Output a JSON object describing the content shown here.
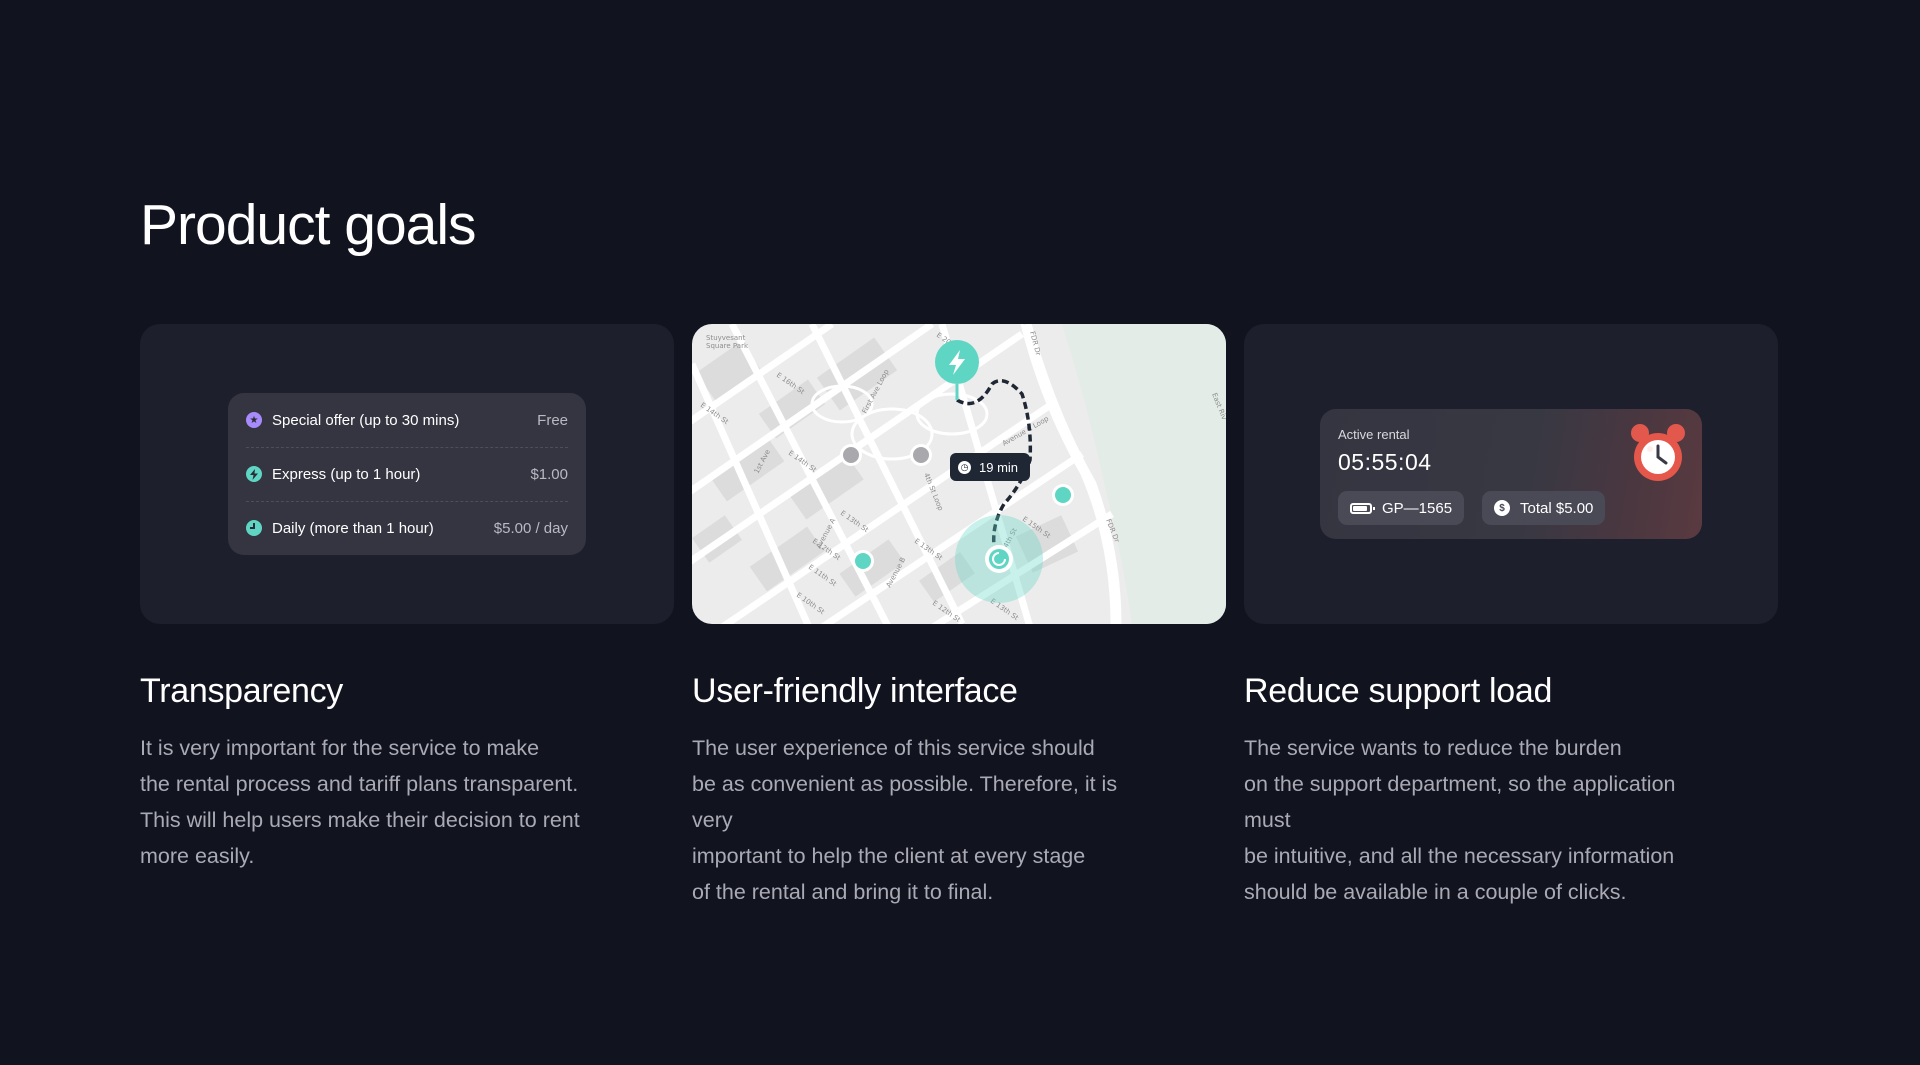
{
  "page": {
    "title": "Product goals"
  },
  "tariffs": [
    {
      "icon": "star-icon",
      "color": "#a78bfa",
      "glyph": "★",
      "label": "Special offer (up to 30 mins)",
      "price": "Free"
    },
    {
      "icon": "lightning-icon",
      "color": "#5fd6c3",
      "glyph": "⚡",
      "label": "Express (up to 1 hour)",
      "price": "$1.00"
    },
    {
      "icon": "clock-icon",
      "color": "#5fd6c3",
      "glyph": "◔",
      "label": "Daily (more than 1 hour)",
      "price": "$5.00 / day"
    }
  ],
  "map": {
    "eta": "19 min",
    "street_labels": [
      "Stuyvesant",
      "Square Park",
      "E 16th St",
      "E 14th St",
      "E 14th St",
      "1st Ave",
      "E 13th St",
      "E 12th St",
      "E 11th St",
      "E 10th St",
      "Avenue A",
      "Avenue B",
      "E 13th St",
      "E 12th St",
      "E 15th St",
      "E 14th St",
      "E 13th St",
      "FDR Dr",
      "FDR Dr",
      "East Riv",
      "Avenue C Loop",
      "4th St Loop",
      "First Ave Loop",
      "E 20"
    ],
    "accent_color": "#5fd6c3"
  },
  "rental": {
    "caption": "Active rental",
    "timer": "05:55:04",
    "vehicle_id": "GP—1565",
    "total": "Total $5.00"
  },
  "columns": [
    {
      "heading": "Transparency",
      "body": "It is very important for the service to make\nthe rental process and tariff plans transparent.\nThis will help users make their decision to rent\nmore easily."
    },
    {
      "heading": "User-friendly interface",
      "body": "The user experience of this service should\nbe as convenient as possible. Therefore, it is very\nimportant to help the client at every stage\nof the rental and bring it to final."
    },
    {
      "heading": "Reduce support load",
      "body": "The service wants to reduce the burden\non the support department, so the application must\nbe intuitive, and all the necessary information\nshould be available in a couple of clicks."
    }
  ]
}
